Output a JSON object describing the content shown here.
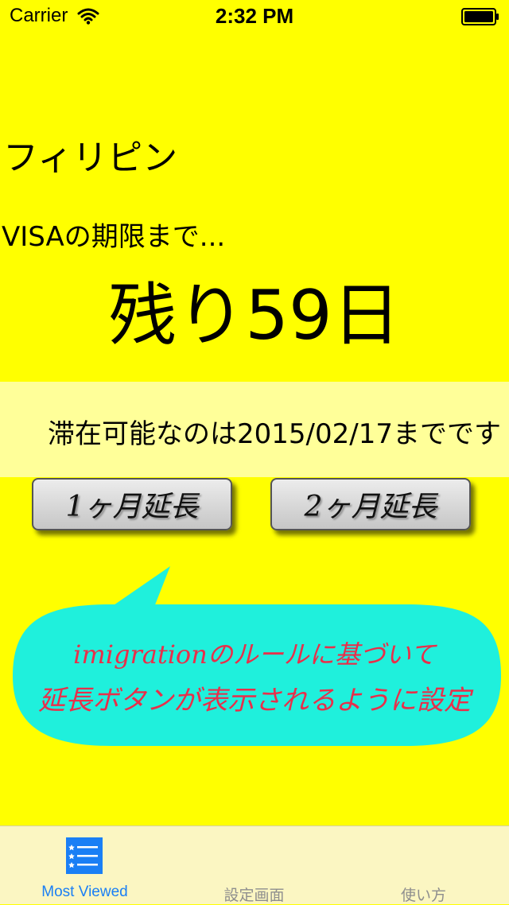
{
  "status_bar": {
    "carrier": "Carrier",
    "time": "2:32 PM",
    "icons": [
      "wifi-icon",
      "battery-icon"
    ]
  },
  "main": {
    "country": "フィリピン",
    "visa_label": "VISAの期限まで...",
    "remaining": "残り59日",
    "stay_until": "滞在可能なのは2015/02/17までです"
  },
  "buttons": {
    "extend_1": "1ヶ月延長",
    "extend_2": "2ヶ月延長"
  },
  "callout": {
    "line1": "imigrationのルールに基づいて",
    "line2": "延長ボタンが表示されるように設定"
  },
  "tab_bar": {
    "tabs": [
      {
        "label": "Most Viewed",
        "icon": "list-icon",
        "selected": true
      },
      {
        "label": "設定画面",
        "selected": false
      },
      {
        "label": "使い方",
        "selected": false
      }
    ]
  },
  "colors": {
    "background": "#ffff00",
    "band": "#ffff99",
    "bubble": "#1ff0dc",
    "callout_text": "#e82f4a",
    "tab_active": "#1a7ff5",
    "tab_inactive": "#8e8e8e",
    "tab_bar": "#fbf6c2"
  }
}
